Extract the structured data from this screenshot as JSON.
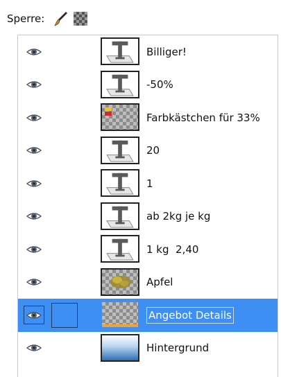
{
  "lock": {
    "label": "Sperre:",
    "icons": [
      "brush-icon",
      "alpha-checker-icon"
    ]
  },
  "layers": [
    {
      "name": "Billiger!",
      "type": "text",
      "visible": true,
      "selected": false
    },
    {
      "name": "-50%",
      "type": "text",
      "visible": true,
      "selected": false
    },
    {
      "name": "Farbkästchen für 33%",
      "type": "image-color-swatches",
      "visible": true,
      "selected": false
    },
    {
      "name": "20",
      "type": "text",
      "visible": true,
      "selected": false
    },
    {
      "name": "1",
      "type": "text",
      "visible": true,
      "selected": false
    },
    {
      "name": "ab 2kg je kg",
      "type": "text",
      "visible": true,
      "selected": false
    },
    {
      "name": "1 kg  2,40",
      "type": "text",
      "visible": true,
      "selected": false
    },
    {
      "name": "Apfel",
      "type": "image-apple",
      "visible": true,
      "selected": false
    },
    {
      "name": "Angebot Details",
      "type": "image-transparent",
      "visible": true,
      "selected": true
    },
    {
      "name": "Hintergrund",
      "type": "image-gradient",
      "visible": true,
      "selected": false
    }
  ],
  "colors": {
    "selection": "#3d8ff3",
    "eye": "#5a6470",
    "accent_red": "#d22a2a",
    "accent_yellow": "#f2c21a",
    "orange_strip": "#f2a233"
  }
}
